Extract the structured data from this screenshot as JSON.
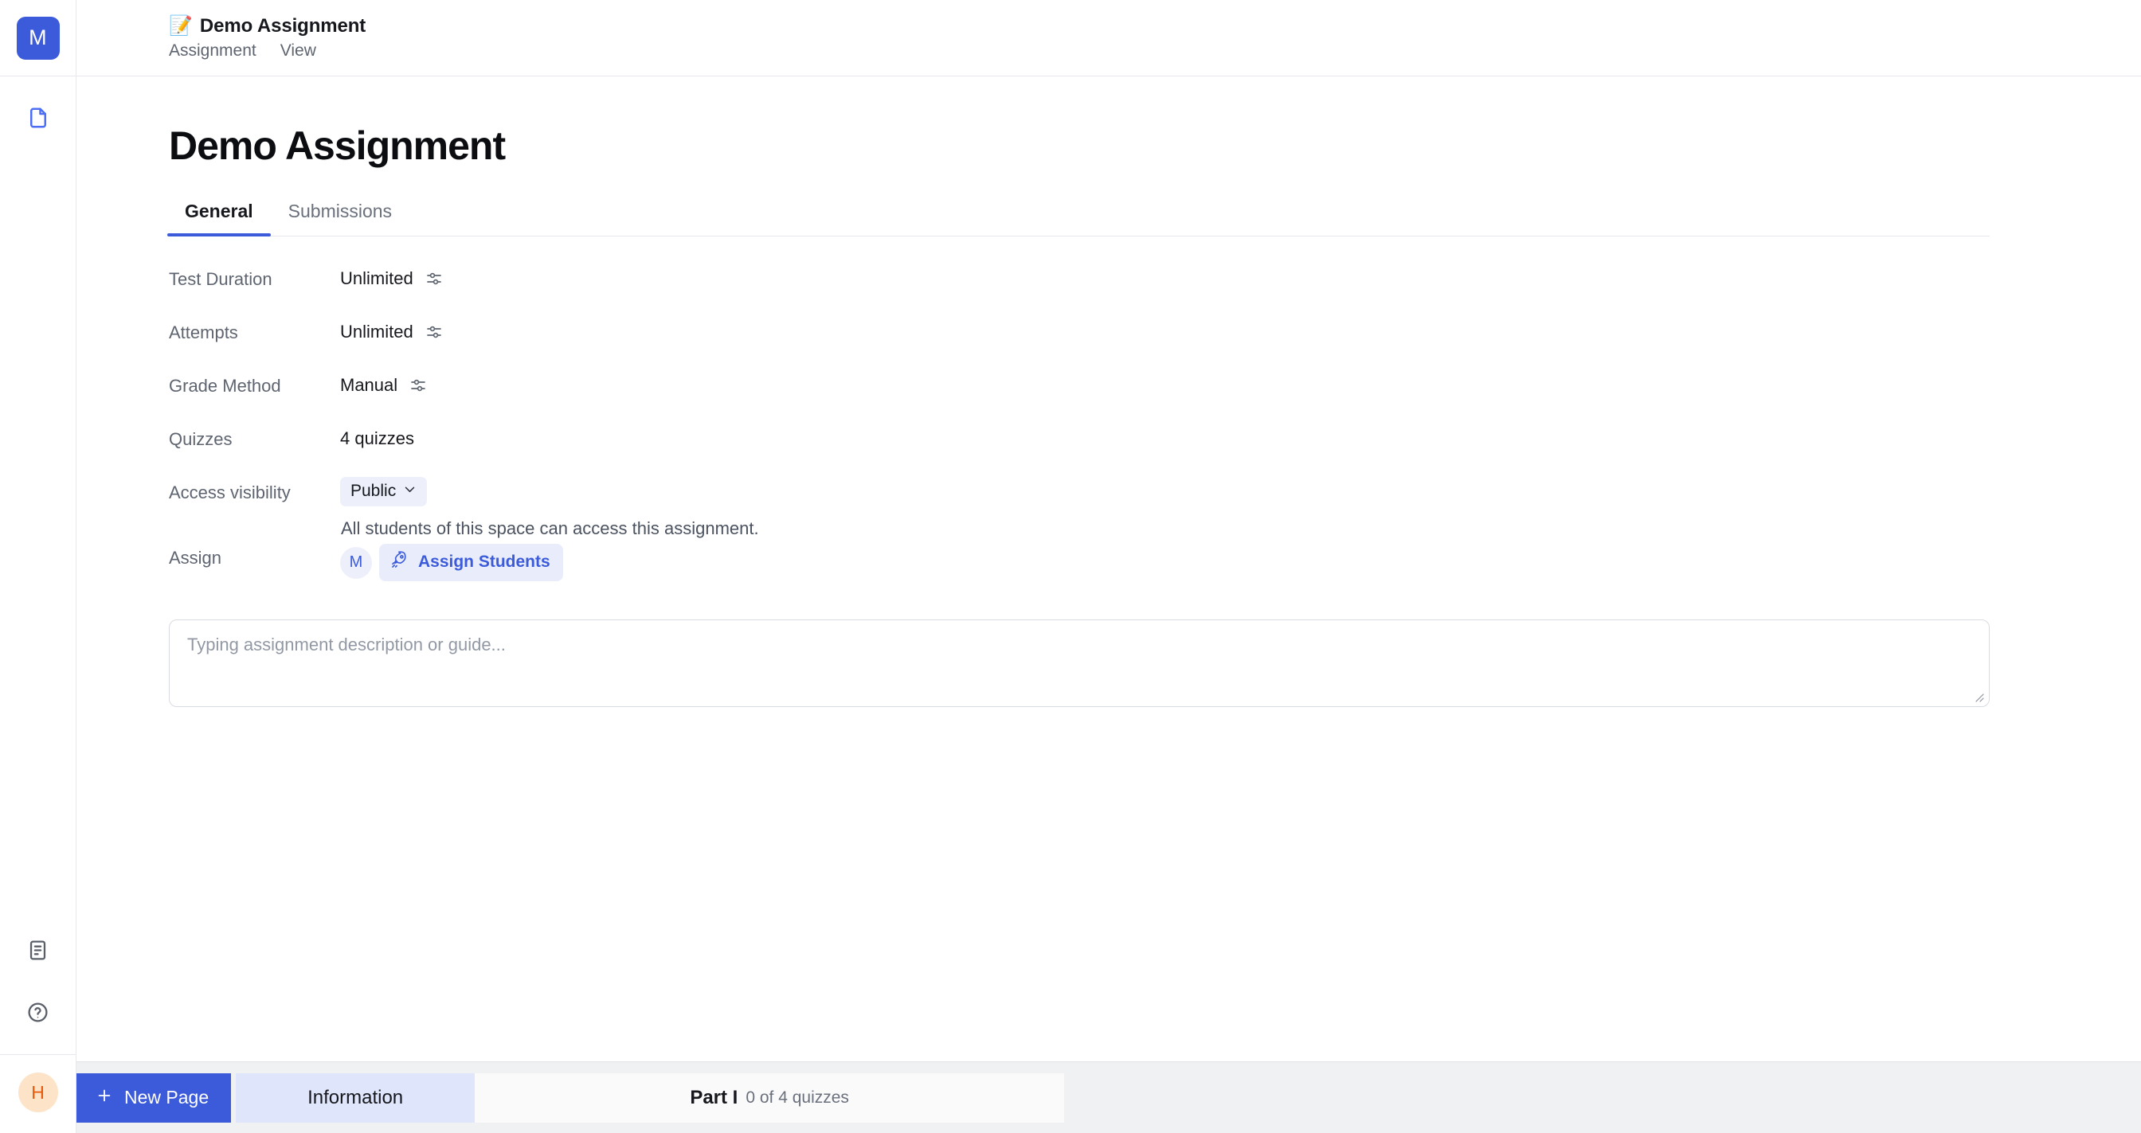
{
  "rail": {
    "workspace_initial": "M",
    "items": [
      {
        "name": "document-icon",
        "label": "Pages"
      }
    ],
    "bottom_items": [
      {
        "name": "notes-icon",
        "label": "Notes"
      },
      {
        "name": "help-icon",
        "label": "Help"
      }
    ],
    "user_initial": "H"
  },
  "topbar": {
    "emoji": "📝",
    "title": "Demo Assignment",
    "breadcrumb": [
      {
        "label": "Assignment"
      },
      {
        "label": "View"
      }
    ]
  },
  "page": {
    "title": "Demo Assignment",
    "tabs": [
      {
        "label": "General",
        "active": true
      },
      {
        "label": "Submissions",
        "active": false
      }
    ],
    "settings": {
      "test_duration": {
        "label": "Test Duration",
        "value": "Unlimited"
      },
      "attempts": {
        "label": "Attempts",
        "value": "Unlimited"
      },
      "grade_method": {
        "label": "Grade Method",
        "value": "Manual"
      },
      "quizzes": {
        "label": "Quizzes",
        "value": "4 quizzes"
      },
      "access_visibility": {
        "label": "Access visibility",
        "value": "Public",
        "helper": "All students of this space can access this assignment."
      },
      "assign": {
        "label": "Assign",
        "avatar_initial": "M",
        "button_label": "Assign Students"
      }
    },
    "description": {
      "placeholder": "Typing assignment description or guide...",
      "value": ""
    }
  },
  "bottombar": {
    "new_page_label": "New Page",
    "new_page_icon": "plus-icon",
    "tabs": [
      {
        "name": "information",
        "label": "Information",
        "meta": "",
        "active": true
      },
      {
        "name": "part-1",
        "label": "Part I",
        "meta": "0 of 4 quizzes",
        "active": false
      }
    ]
  },
  "colors": {
    "accent": "#3b5bdb",
    "accent_soft": "#e9edfb",
    "avatar_orange_bg": "#fde3c7",
    "avatar_orange_fg": "#e8590c",
    "bottombar_bg": "#f0f1f3",
    "border": "#e7e8ec"
  }
}
